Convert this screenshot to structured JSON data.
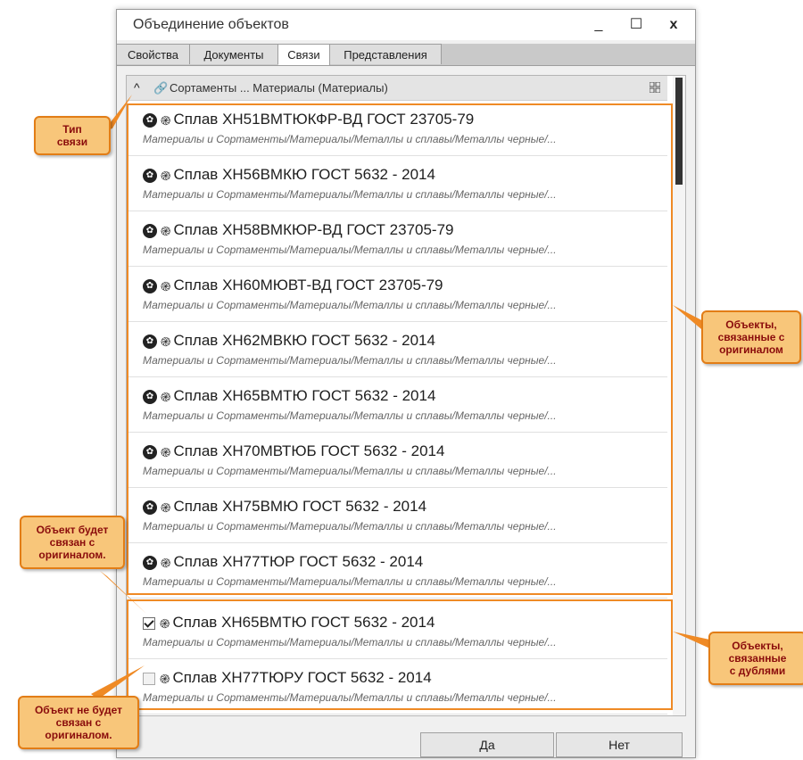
{
  "window": {
    "title": "Объединение объектов",
    "minimize": "_",
    "maximize": "☐",
    "close": "x"
  },
  "tabs": [
    {
      "label": "Свойства"
    },
    {
      "label": "Документы"
    },
    {
      "label": "Связи"
    },
    {
      "label": "Представления"
    }
  ],
  "active_tab": "Связи",
  "group": {
    "label": "Сортаменты ... Материалы (Материалы)",
    "collapse_icon": "chevron-up-icon",
    "link_icon": "link-icon",
    "layout_icon": "grid-icon"
  },
  "linked_items": [
    {
      "name": "Сплав ХН51ВМТЮКФР-ВД ГОСТ 23705-79",
      "path": "Материалы и Сортаменты/Материалы/Металлы и сплавы/Металлы черные/..."
    },
    {
      "name": "Сплав ХН56ВМКЮ ГОСТ 5632 - 2014",
      "path": "Материалы и Сортаменты/Материалы/Металлы и сплавы/Металлы черные/..."
    },
    {
      "name": "Сплав ХН58ВМКЮР-ВД ГОСТ 23705-79",
      "path": "Материалы и Сортаменты/Материалы/Металлы и сплавы/Металлы черные/..."
    },
    {
      "name": "Сплав ХН60МЮВТ-ВД ГОСТ 23705-79",
      "path": "Материалы и Сортаменты/Материалы/Металлы и сплавы/Металлы черные/..."
    },
    {
      "name": "Сплав ХН62МВКЮ ГОСТ 5632 - 2014",
      "path": "Материалы и Сортаменты/Материалы/Металлы и сплавы/Металлы черные/..."
    },
    {
      "name": "Сплав ХН65ВМТЮ ГОСТ 5632 - 2014",
      "path": "Материалы и Сортаменты/Материалы/Металлы и сплавы/Металлы черные/..."
    },
    {
      "name": "Сплав ХН70МВТЮБ ГОСТ 5632 - 2014",
      "path": "Материалы и Сортаменты/Материалы/Металлы и сплавы/Металлы черные/..."
    },
    {
      "name": "Сплав ХН75ВМЮ ГОСТ 5632 - 2014",
      "path": "Материалы и Сортаменты/Материалы/Металлы и сплавы/Металлы черные/..."
    },
    {
      "name": "Сплав ХН77ТЮР ГОСТ 5632 - 2014",
      "path": "Материалы и Сортаменты/Материалы/Металлы и сплавы/Металлы черные/..."
    }
  ],
  "duplicate_items": [
    {
      "name": "Сплав ХН65ВМТЮ ГОСТ 5632 - 2014",
      "path": "Материалы и Сортаменты/Материалы/Металлы и сплавы/Металлы черные/...",
      "checked": true
    },
    {
      "name": "Сплав ХН77ТЮРУ ГОСТ 5632 - 2014",
      "path": "Материалы и Сортаменты/Материалы/Металлы и сплавы/Металлы черные/...",
      "checked": false
    }
  ],
  "buttons": {
    "yes": "Да",
    "no": "Нет"
  },
  "callouts": {
    "link_type": "Тип\nсвязи",
    "linked_objects": "Объекты,\nсвязанные с\nоригиналом",
    "will_link": "Объект будет\nсвязан с\nоригиналом.",
    "duplicates": "Объекты,\nсвязанные\nс дублями",
    "wont_link": "Объект не будет\nсвязан с\nоригиналом."
  },
  "colors": {
    "highlight_border": "#ef8a25",
    "callout_bg": "#f8c67a",
    "callout_text": "#8a0c0c"
  }
}
